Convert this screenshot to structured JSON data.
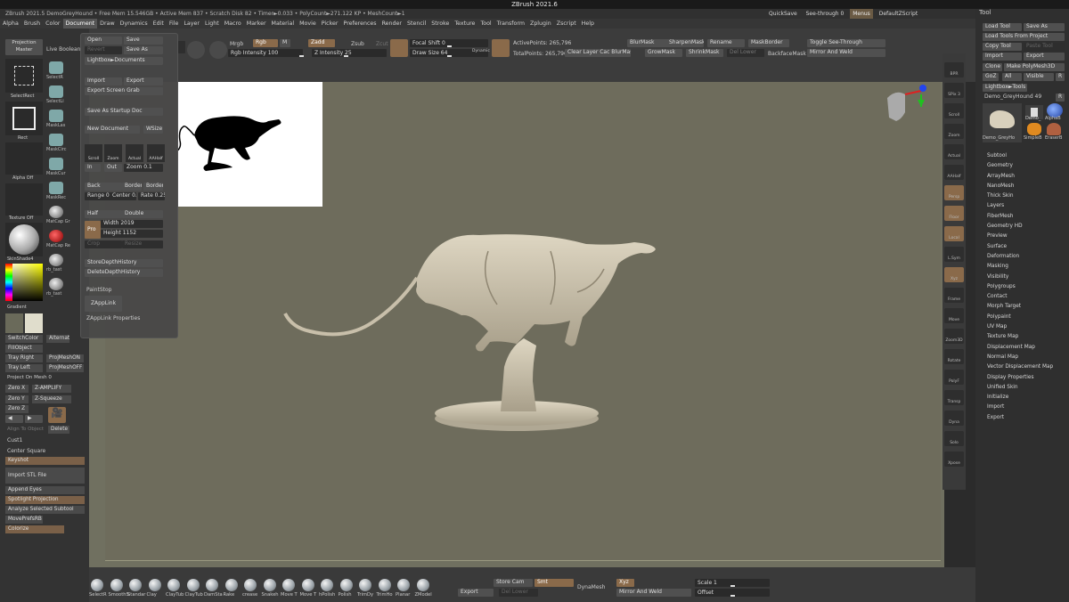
{
  "window": {
    "title": "ZBrush 2021.6"
  },
  "infobar": {
    "text": "ZBrush 2021.5 DemoGreyHound  • Free Mem 15.546GB • Active Mem 837 • Scratch Disk 82 •  Timer►0.033 • PolyCount►271.122 KP  • MeshCount►1"
  },
  "quick": {
    "quicksave": "QuickSave",
    "seethrough": "See-through  0",
    "menus": "Menus",
    "script": "DefaultZScript"
  },
  "menubar": [
    "Alpha",
    "Brush",
    "Color",
    "Document",
    "Draw",
    "Dynamics",
    "Edit",
    "File",
    "Layer",
    "Light",
    "Macro",
    "Marker",
    "Material",
    "Movie",
    "Picker",
    "Preferences",
    "Render",
    "Stencil",
    "Stroke",
    "Texture",
    "Tool",
    "Transform",
    "Zplugin",
    "Zscript",
    "Help"
  ],
  "menubar_active": "Document",
  "topshelf": {
    "mrgb": "Mrgb",
    "rgb": "Rgb",
    "m": "M",
    "rgb_intensity": "Rgb Intensity 100",
    "zadd": "Zadd",
    "zsub": "Zsub",
    "zcut": "Zcut",
    "z_intensity": "Z Intensity 25",
    "focal_shift": "Focal Shift 0",
    "draw_size": "Draw Size 64",
    "dynamic": "Dynamic",
    "active_points": "ActivePoints: 265,796",
    "total_points": "TotalPoints: 265,796",
    "blurmask": "BlurMask",
    "sharpenmask": "SharpenMask",
    "rename": "Rename",
    "maskborder": "MaskBorder",
    "toggle_seethrough": "Toggle See-Through",
    "clear_layer": "Clear Layer Cac BlurMask",
    "growmask": "GrowMask",
    "shrinkmask": "ShrinkMask",
    "del_lower": "Del Lower",
    "backfacemask": "BackfaceMask",
    "mirror_weld": "Mirror And Weld",
    "live_boolean": "Live Boolean"
  },
  "leftpanel": {
    "projection_master": "Projection Master",
    "select_rect": "SelectRect",
    "rect": "Rect",
    "alpha_off": "Alpha Off",
    "texture_off": "Texture Off",
    "skinshade": "SkinShade4",
    "gradient": "Gradient",
    "switch_color": "SwitchColor",
    "alternate": "Alternate",
    "fill_object": "FillObject",
    "tray_right": "Tray Right",
    "projmesh_on": "ProjMeshON",
    "tray_left": "Tray Left",
    "projmesh_off": "ProjMeshOFF",
    "project_on_mesh": "Project On Mesh 0",
    "zero_x": "Zero X",
    "z_amplify": "Z-AMPLIFY",
    "zero_y": "Zero Y",
    "z_squeeze": "Z-Squeeze",
    "zero_z": "Zero Z",
    "align_to_object": "Align To Object",
    "delete": "Delete",
    "cust1": "Cust1",
    "center_square": "Center  Square",
    "keyshot": "Keyshot",
    "import_stl": "Import STL File",
    "append_eyes": "Append Eyes",
    "spotlight_projection": "Spotlight Projection",
    "analyze_subtool": "Analyze Selected Subtool",
    "moveprefs": "MovePrefsRB",
    "colorize": "Colorize",
    "col2": [
      "SelectR",
      "SelectLi",
      "MaskLas",
      "MaskCirc",
      "MaskCur",
      "MaskRec",
      "MatCap Gr",
      "MatCap Re",
      "rb_tast",
      "rb_tast"
    ]
  },
  "docpanel": {
    "open": "Open",
    "save": "Save",
    "revert": "Revert",
    "save_as": "Save As",
    "lightbox_documents": "Lightbox►Documents",
    "import": "Import",
    "export": "Export",
    "export_screen_grab": "Export Screen Grab",
    "save_as_startup": "Save As Startup Doc",
    "new_document": "New Document",
    "wsize": "WSize",
    "scroll": "Scroll",
    "zoom": "Zoom",
    "actual": "Actual",
    "aahalf": "AAHalf",
    "in": "In",
    "out": "Out",
    "zoom_val": "Zoom 0.1",
    "back": "Back",
    "border": "Border",
    "border2": "Border2",
    "range": "Range 0.0",
    "center": "Center 0.7",
    "rate": "Rate 0.25",
    "half": "Half",
    "double": "Double",
    "pro": "Pro",
    "width": "Width 2019",
    "height": "Height 1152",
    "crop": "Crop",
    "resize": "Resize",
    "store_depth": "StoreDepthHistory",
    "delete_depth": "DeleteDepthHistory",
    "paintstop": "PaintStop",
    "zapplink": "ZAppLink",
    "zapplink_props": "ZAppLink Properties"
  },
  "rightnav": [
    {
      "label": "BPR",
      "on": false
    },
    {
      "label": "SPix 3",
      "on": false
    },
    {
      "label": "Scroll",
      "on": false
    },
    {
      "label": "Zoom",
      "on": false
    },
    {
      "label": "Actual",
      "on": false
    },
    {
      "label": "AAHalf",
      "on": false
    },
    {
      "label": "Persp",
      "on": true
    },
    {
      "label": "Floor",
      "on": true
    },
    {
      "label": "Local",
      "on": true
    },
    {
      "label": "L.Sym",
      "on": false
    },
    {
      "label": "Xyz",
      "on": true
    },
    {
      "label": "Frame",
      "on": false
    },
    {
      "label": "Move",
      "on": false
    },
    {
      "label": "Zoom3D",
      "on": false
    },
    {
      "label": "Rotate",
      "on": false
    },
    {
      "label": "PolyF",
      "on": false
    },
    {
      "label": "Transp",
      "on": false
    },
    {
      "label": "Dyna",
      "on": false
    },
    {
      "label": "Solo",
      "on": false
    },
    {
      "label": "Xpose",
      "on": false
    }
  ],
  "rightpanel": {
    "tool": "Tool",
    "load_tool": "Load Tool",
    "save_as": "Save As",
    "load_from_project": "Load Tools From Project",
    "copy_tool": "Copy Tool",
    "paste_tool": "Paste Tool",
    "import": "Import",
    "export": "Export",
    "clone": "Clone",
    "make_polymesh": "Make PolyMesh3D",
    "goz": "GoZ",
    "all": "All",
    "visible": "Visible",
    "r": "R",
    "lightbox_tools": "Lightbox►Tools",
    "demo_greyhound": "Demo_GreyHound  49",
    "thumb1": "Demo_GreyHo",
    "thumb2": "Demo_",
    "thumb3": "AlphaB",
    "thumb4": "SimpleB",
    "thumb5": "EraserB",
    "menu": [
      "Subtool",
      "Geometry",
      "ArrayMesh",
      "NanoMesh",
      "Thick Skin",
      "Layers",
      "FiberMesh",
      "Geometry HD",
      "Preview",
      "Surface",
      "Deformation",
      "Masking",
      "Visibility",
      "Polygroups",
      "Contact",
      "Morph Target",
      "Polypaint",
      "UV Map",
      "Texture Map",
      "Displacement Map",
      "Normal Map",
      "Vector Displacement Map",
      "Display Properties",
      "Unified Skin",
      "Initialize",
      "Import",
      "Export"
    ]
  },
  "bottomshelf": {
    "brushes": [
      "SelectR",
      "SmoothS",
      "Standar",
      "Clay",
      "ClayTub",
      "ClayTub",
      "DamSta",
      "Rake",
      "crease",
      "Snakeh",
      "Move T",
      "Move T",
      "hPolish",
      "Polish",
      "TrimDy",
      "TrimHo",
      "Planar",
      "ZModel"
    ],
    "store_cam": "Store Cam",
    "smt": "Smt",
    "export": "Export",
    "del_lower": "Del Lower",
    "dynamesh": "DynaMesh",
    "xyz": "Xyz",
    "mirror_weld": "Mirror And Weld",
    "scale": "Scale 1",
    "offset": "Offset"
  },
  "colors": {
    "accent": "#8a6a4a",
    "canvas": "#6e6c5c",
    "model": "#cfc6b2"
  }
}
